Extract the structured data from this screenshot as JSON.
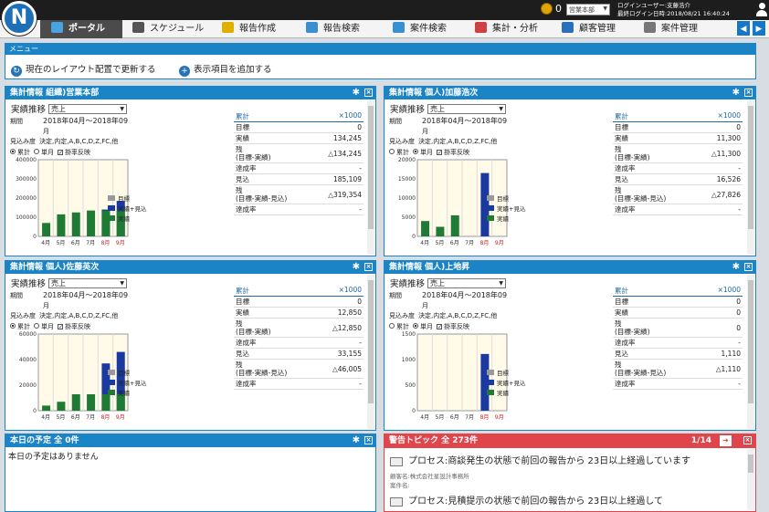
{
  "app": {
    "logo": "N",
    "points": "0",
    "dept": "営業本部",
    "user_line1": "ログインユーザー:支藤浩介",
    "user_line2": "最終ログイン日時:2018/08/21 16:40:24"
  },
  "nav": [
    {
      "label": "ポータル",
      "icon": "portal-icon",
      "color": "#4aa3df"
    },
    {
      "label": "スケジュール",
      "icon": "calendar-icon",
      "color": "#555"
    },
    {
      "label": "報告作成",
      "icon": "pen-icon",
      "color": "#e0b000"
    },
    {
      "label": "報告検索",
      "icon": "search-doc-icon",
      "color": "#3a8fd0"
    },
    {
      "label": "案件検索",
      "icon": "folder-icon",
      "color": "#3a8fd0"
    },
    {
      "label": "集計・分析",
      "icon": "pie-chart-icon",
      "color": "#d04040"
    },
    {
      "label": "顧客管理",
      "icon": "building-icon",
      "color": "#2a6fba"
    },
    {
      "label": "案件管理",
      "icon": "chart-window-icon",
      "color": "#777"
    }
  ],
  "menu": {
    "title": "メニュー",
    "action1": "現在のレイアウト配置で更新する",
    "action2": "表示項目を追加する"
  },
  "common": {
    "row_label": "実績推移",
    "row_select": "売上",
    "period_label": "期間",
    "period_value": "2018年04月〜2018年09",
    "period_tail": "月",
    "mikomi_label": "見込み度",
    "mikomi_value": "決定,内定,A,B,C,D,Z,FC,他",
    "opt_cumulative": "累計",
    "opt_monthly": "単月",
    "opt_rate": "掛率反映",
    "unit": "×1000",
    "stat_header": "累計",
    "legend": [
      "目標",
      "実績+見込",
      "実績"
    ],
    "months": [
      "4月",
      "5月",
      "6月",
      "7月",
      "8月",
      "9月"
    ]
  },
  "panels": [
    {
      "title": "集計情報 組織)営業本部",
      "mode": "cumulative",
      "y_ticks": [
        "400000",
        "300000",
        "200000",
        "100000",
        "0"
      ],
      "stats": [
        {
          "label": "目標",
          "value": "0"
        },
        {
          "label": "実績",
          "value": "134,245"
        },
        {
          "label": "残\n(目標-実績)",
          "value": "△134,245"
        },
        {
          "label": "達成率",
          "value": "-"
        },
        {
          "label": "見込",
          "value": "185,109"
        },
        {
          "label": "残\n(目標-実績-見込)",
          "value": "△319,354"
        },
        {
          "label": "達成率",
          "value": "-"
        }
      ]
    },
    {
      "title": "集計情報 個人)加藤浩次",
      "mode": "monthly",
      "y_ticks": [
        "20000",
        "15000",
        "10000",
        "5000",
        "0"
      ],
      "stats": [
        {
          "label": "目標",
          "value": "0"
        },
        {
          "label": "実績",
          "value": "11,300"
        },
        {
          "label": "残\n(目標-実績)",
          "value": "△11,300"
        },
        {
          "label": "達成率",
          "value": "-"
        },
        {
          "label": "見込",
          "value": "16,526"
        },
        {
          "label": "残\n(目標-実績-見込)",
          "value": "△27,826"
        },
        {
          "label": "達成率",
          "value": "-"
        }
      ]
    },
    {
      "title": "集計情報 個人)佐藤英次",
      "mode": "cumulative",
      "y_ticks": [
        "60000",
        "40000",
        "20000",
        "0"
      ],
      "stats": [
        {
          "label": "目標",
          "value": "0"
        },
        {
          "label": "実績",
          "value": "12,850"
        },
        {
          "label": "残\n(目標-実績)",
          "value": "△12,850"
        },
        {
          "label": "達成率",
          "value": "-"
        },
        {
          "label": "見込",
          "value": "33,155"
        },
        {
          "label": "残\n(目標-実績-見込)",
          "value": "△46,005"
        },
        {
          "label": "達成率",
          "value": "-"
        }
      ]
    },
    {
      "title": "集計情報 個人)上地昇",
      "mode": "monthly",
      "y_ticks": [
        "1500",
        "1000",
        "500",
        "0"
      ],
      "stats": [
        {
          "label": "目標",
          "value": "0"
        },
        {
          "label": "実績",
          "value": "0"
        },
        {
          "label": "残\n(目標-実績)",
          "value": "0"
        },
        {
          "label": "達成率",
          "value": "-"
        },
        {
          "label": "見込",
          "value": "1,110"
        },
        {
          "label": "残\n(目標-実績-見込)",
          "value": "△1,110"
        },
        {
          "label": "達成率",
          "value": "-"
        }
      ]
    }
  ],
  "chart_data": [
    {
      "type": "bar",
      "title": "集計情報 組織)営業本部",
      "categories": [
        "4月",
        "5月",
        "6月",
        "7月",
        "8月",
        "9月"
      ],
      "ylim": [
        0,
        400000
      ],
      "series": [
        {
          "name": "実績",
          "values": [
            70000,
            115000,
            125000,
            135000,
            134245,
            134245
          ],
          "color": "#1e7a34"
        },
        {
          "name": "実績+見込",
          "values": [
            0,
            0,
            0,
            0,
            140000,
            185109
          ],
          "color": "#1a3aa0"
        }
      ]
    },
    {
      "type": "bar",
      "title": "集計情報 個人)加藤浩次",
      "categories": [
        "4月",
        "5月",
        "6月",
        "7月",
        "8月",
        "9月"
      ],
      "ylim": [
        0,
        20000
      ],
      "series": [
        {
          "name": "実績",
          "values": [
            4000,
            2500,
            5500,
            0,
            0,
            0
          ],
          "color": "#1e7a34"
        },
        {
          "name": "実績+見込",
          "values": [
            0,
            0,
            0,
            0,
            16526,
            0
          ],
          "color": "#1a3aa0"
        }
      ]
    },
    {
      "type": "bar",
      "title": "集計情報 個人)佐藤英次",
      "categories": [
        "4月",
        "5月",
        "6月",
        "7月",
        "8月",
        "9月"
      ],
      "ylim": [
        0,
        60000
      ],
      "series": [
        {
          "name": "実績",
          "values": [
            4000,
            7000,
            12850,
            12850,
            12850,
            12850
          ],
          "color": "#1e7a34"
        },
        {
          "name": "実績+見込",
          "values": [
            0,
            0,
            0,
            0,
            37000,
            46005
          ],
          "color": "#1a3aa0"
        }
      ]
    },
    {
      "type": "bar",
      "title": "集計情報 個人)上地昇",
      "categories": [
        "4月",
        "5月",
        "6月",
        "7月",
        "8月",
        "9月"
      ],
      "ylim": [
        0,
        1500
      ],
      "series": [
        {
          "name": "実績",
          "values": [
            0,
            0,
            0,
            0,
            0,
            0
          ],
          "color": "#1e7a34"
        },
        {
          "name": "実績+見込",
          "values": [
            0,
            0,
            0,
            0,
            1110,
            0
          ],
          "color": "#1a3aa0"
        }
      ]
    }
  ],
  "schedule": {
    "title": "本日の予定 全 0件",
    "empty": "本日の予定はありません"
  },
  "alerts": {
    "title": "警告トピック 全 273件",
    "page": "1/14",
    "items": [
      {
        "text": "プロセス:商談発生の状態で前回の報告から 23日以上経過しています",
        "customer": "顧客名:株式会社星設計事務所",
        "project": "案件名:"
      },
      {
        "text": "プロセス:見積提示の状態で前回の報告から 23日以上経過して"
      }
    ]
  }
}
